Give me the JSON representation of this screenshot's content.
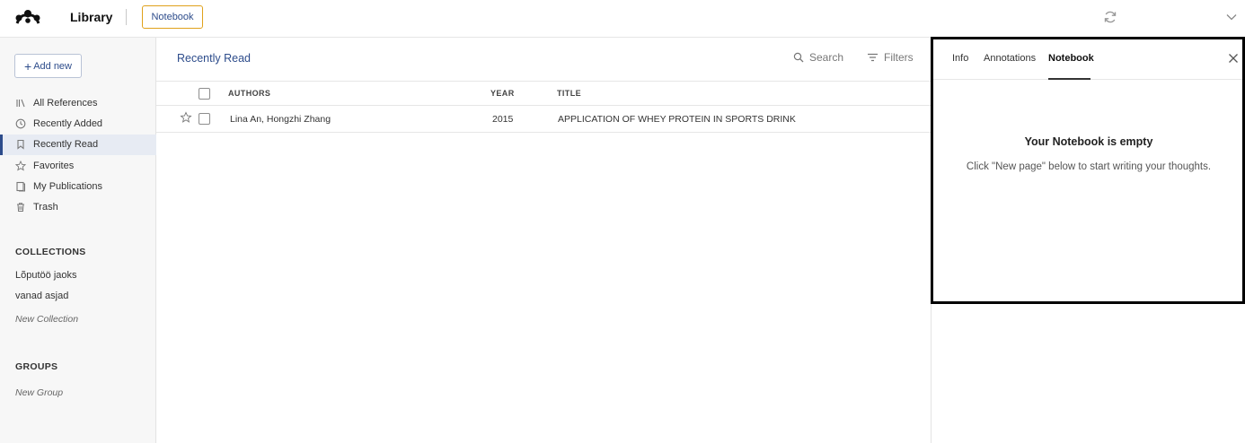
{
  "header": {
    "app_title": "Library",
    "notebook_button": "Notebook"
  },
  "sidebar": {
    "add_new": "Add new",
    "nav": [
      {
        "label": "All References",
        "icon": "library-icon"
      },
      {
        "label": "Recently Added",
        "icon": "clock-icon"
      },
      {
        "label": "Recently Read",
        "icon": "bookmark-icon",
        "active": true
      },
      {
        "label": "Favorites",
        "icon": "star-icon"
      },
      {
        "label": "My Publications",
        "icon": "publications-icon"
      },
      {
        "label": "Trash",
        "icon": "trash-icon"
      }
    ],
    "collections_header": "COLLECTIONS",
    "collections": [
      "Lõputöö jaoks",
      "vanad asjad"
    ],
    "new_collection": "New Collection",
    "groups_header": "GROUPS",
    "new_group": "New Group"
  },
  "main": {
    "title": "Recently Read",
    "search_label": "Search",
    "filters_label": "Filters",
    "columns": {
      "authors": "AUTHORS",
      "year": "YEAR",
      "title": "TITLE"
    },
    "rows": [
      {
        "authors": "Lina An, Hongzhi Zhang",
        "year": "2015",
        "title": "APPLICATION OF WHEY PROTEIN IN SPORTS DRINK"
      }
    ]
  },
  "panel": {
    "tabs": [
      "Info",
      "Annotations",
      "Notebook"
    ],
    "active_tab": "Notebook",
    "empty_title": "Your Notebook is empty",
    "empty_desc": "Click \"New page\" below to start writing your thoughts."
  },
  "colors": {
    "accent": "#2d4c8b",
    "notebook_border": "#e0a11b"
  }
}
